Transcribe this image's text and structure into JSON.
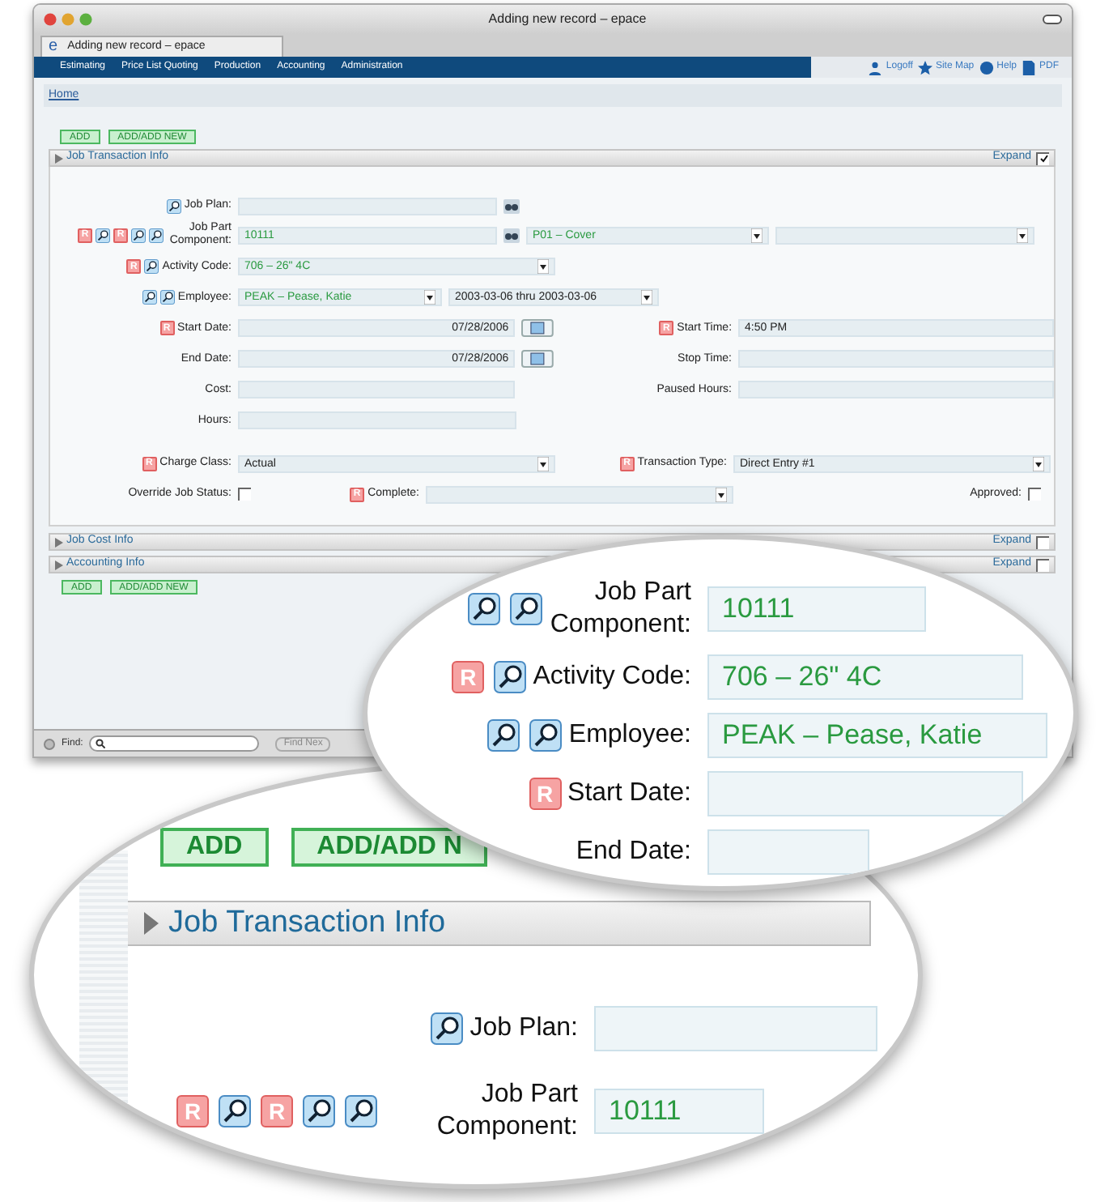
{
  "window": {
    "title": "Adding new record – epace"
  },
  "browser_tab": {
    "title": "Adding new record – epace",
    "logo": "e"
  },
  "nav": {
    "items": [
      "Estimating",
      "Price List Quoting",
      "Production",
      "Accounting",
      "Administration"
    ],
    "links": [
      {
        "kind": "person",
        "label": "Logoff"
      },
      {
        "kind": "star",
        "label": "Site Map"
      },
      {
        "kind": "globe",
        "label": "Help"
      },
      {
        "kind": "doc",
        "label": "PDF"
      }
    ]
  },
  "breadcrumb": "Home",
  "top_buttons": [
    "ADD",
    "ADD/ADD NEW"
  ],
  "main_section": {
    "title": "Job Transaction Info",
    "expand_label": "Expand",
    "checked": true
  },
  "form": {
    "rows": [
      {
        "kind": "plan",
        "badges": [
          {
            "kind": "lookup"
          }
        ],
        "label": "Job Plan:"
      },
      {
        "kind": "part",
        "badges": [
          {
            "kind": "required",
            "text": "R"
          },
          {
            "kind": "lookup"
          },
          {
            "kind": "required",
            "text": "R"
          },
          {
            "kind": "lookup"
          },
          {
            "kind": "lookup"
          }
        ],
        "label": "Job Part Component:",
        "value": "10111",
        "select_1": "P01 – Cover"
      },
      {
        "kind": "select",
        "badges": [
          {
            "kind": "required",
            "text": "R"
          },
          {
            "kind": "lookup"
          }
        ],
        "label": "Activity Code:",
        "value": "706 – 26\" 4C"
      },
      {
        "kind": "employee",
        "badges": [
          {
            "kind": "lookup"
          },
          {
            "kind": "lookup"
          }
        ],
        "label": "Employee:",
        "value": "PEAK – Pease, Katie",
        "period": "2003-03-06 thru 2003-03-06"
      },
      {
        "kind": "pair",
        "badges": [
          {
            "kind": "required",
            "text": "R"
          }
        ],
        "label": "Start Date:",
        "value": "07/28/2006",
        "calendar": true,
        "right": {
          "badges": [
            {
              "kind": "required",
              "text": "R"
            }
          ],
          "label": "Start Time:",
          "value": "4:50 PM"
        }
      },
      {
        "kind": "pair",
        "label": "End Date:",
        "value": "07/28/2006",
        "calendar": true,
        "right": {
          "label": "Stop Time:"
        }
      },
      {
        "kind": "pair",
        "label": "Cost:",
        "calendar": false,
        "right": {
          "label": "Paused Hours:"
        }
      },
      {
        "kind": "pair",
        "label": "Hours:",
        "calendar": false
      },
      {
        "kind": "pair_select",
        "badges": [
          {
            "kind": "required",
            "text": "R"
          }
        ],
        "label": "Charge Class:",
        "value": "Actual",
        "right": {
          "badges": [
            {
              "kind": "required",
              "text": "R"
            }
          ],
          "label": "Transaction Type:",
          "value": "Direct Entry #1"
        }
      },
      {
        "kind": "status",
        "label": "Override Job Status:",
        "checked": false,
        "middle": {
          "badges": [
            {
              "kind": "required",
              "text": "R"
            }
          ],
          "label": "Complete:"
        },
        "right": {
          "label": "Approved:",
          "checked": false
        }
      }
    ]
  },
  "other_sections": [
    {
      "title": "Job Cost Info",
      "expand_label": "Expand",
      "checked": false
    },
    {
      "title": "Accounting Info",
      "expand_label": "Expand",
      "checked": false
    }
  ],
  "bottom_buttons": [
    "ADD",
    "ADD/ADD NEW"
  ],
  "find_bar": {
    "label": "Find:",
    "next": "Find Nex"
  },
  "magnifier_top": {
    "rows": [
      {
        "badges": [
          {
            "kind": "lookup"
          },
          {
            "kind": "lookup"
          }
        ],
        "label": "Job Part Component:",
        "value": "10111"
      },
      {
        "badges": [
          {
            "kind": "required",
            "text": "R"
          },
          {
            "kind": "lookup"
          }
        ],
        "label": "Activity Code:",
        "value": "706 – 26\" 4C"
      },
      {
        "badges": [
          {
            "kind": "lookup"
          },
          {
            "kind": "lookup"
          }
        ],
        "label": "Employee:",
        "value": "PEAK – Pease, Katie"
      },
      {
        "badges": [
          {
            "kind": "required",
            "text": "R"
          }
        ],
        "label": "Start Date:"
      },
      {
        "label": "End Date:"
      }
    ]
  },
  "magnifier_bottom": {
    "buttons": [
      "ADD",
      "ADD/ADD N"
    ],
    "section_title": "Job Transaction Info",
    "rows": [
      {
        "badges": [
          {
            "kind": "lookup"
          }
        ],
        "label": "Job Plan:"
      },
      {
        "badges": [
          {
            "kind": "required",
            "text": "R"
          },
          {
            "kind": "lookup"
          },
          {
            "kind": "required",
            "text": "R"
          },
          {
            "kind": "lookup"
          },
          {
            "kind": "lookup"
          }
        ],
        "label": "Job Part Component:",
        "value": "10111"
      }
    ]
  }
}
